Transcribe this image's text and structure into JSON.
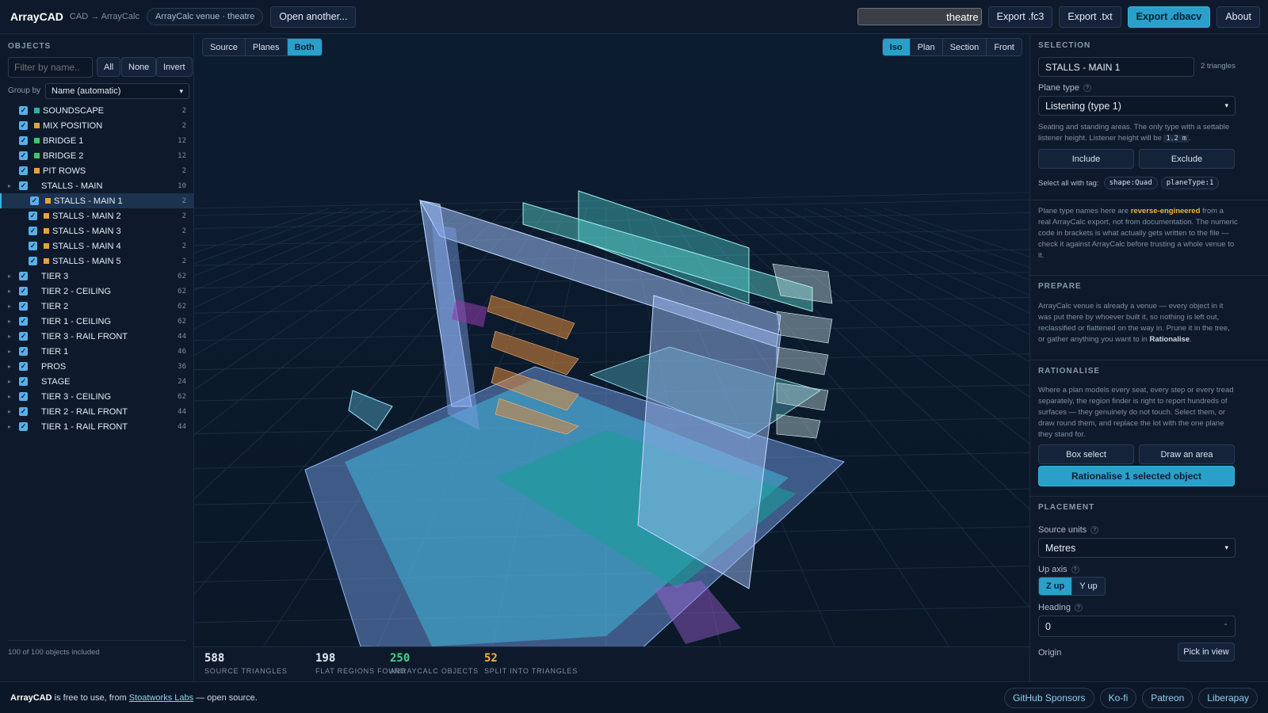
{
  "topbar": {
    "brand": "ArrayCAD",
    "crumb": "CAD → ArrayCalc",
    "venue_pill": "ArrayCalc venue · theatre",
    "open_another": "Open another...",
    "search_value": "theatre",
    "export_fc3": "Export .fc3",
    "export_txt": "Export .txt",
    "export_dbacv": "Export .dbacv",
    "about": "About"
  },
  "objects": {
    "title": "OBJECTS",
    "filter_placeholder": "Filter by name..",
    "all": "All",
    "none": "None",
    "invert": "Invert",
    "group_by_label": "Group by",
    "group_by_value": "Name (automatic)",
    "footer": "100 of 100 objects included",
    "items": [
      {
        "name": "SOUNDSCAPE",
        "count": "2",
        "color": "#2bb3a8",
        "indent": 0,
        "caret": false,
        "selected": false
      },
      {
        "name": "MIX POSITION",
        "count": "2",
        "color": "#e8a23a",
        "indent": 0,
        "caret": false,
        "selected": false
      },
      {
        "name": "BRIDGE 1",
        "count": "12",
        "color": "#45c46a",
        "indent": 0,
        "caret": false,
        "selected": false
      },
      {
        "name": "BRIDGE 2",
        "count": "12",
        "color": "#45c46a",
        "indent": 0,
        "caret": false,
        "selected": false
      },
      {
        "name": "PIT ROWS",
        "count": "2",
        "color": "#e8a23a",
        "indent": 0,
        "caret": false,
        "selected": false
      },
      {
        "name": "STALLS - MAIN",
        "count": "10",
        "color": "",
        "indent": 0,
        "caret": true,
        "selected": false
      },
      {
        "name": "STALLS - MAIN 1",
        "count": "2",
        "color": "#e8a23a",
        "indent": 1,
        "caret": false,
        "selected": true
      },
      {
        "name": "STALLS - MAIN 2",
        "count": "2",
        "color": "#e8a23a",
        "indent": 1,
        "caret": false,
        "selected": false
      },
      {
        "name": "STALLS - MAIN 3",
        "count": "2",
        "color": "#e8a23a",
        "indent": 1,
        "caret": false,
        "selected": false
      },
      {
        "name": "STALLS - MAIN 4",
        "count": "2",
        "color": "#e8a23a",
        "indent": 1,
        "caret": false,
        "selected": false
      },
      {
        "name": "STALLS - MAIN 5",
        "count": "2",
        "color": "#e8a23a",
        "indent": 1,
        "caret": false,
        "selected": false
      },
      {
        "name": "TIER 3",
        "count": "62",
        "color": "",
        "indent": 0,
        "caret": true,
        "selected": false
      },
      {
        "name": "TIER 2 - CEILING",
        "count": "62",
        "color": "",
        "indent": 0,
        "caret": true,
        "selected": false
      },
      {
        "name": "TIER 2",
        "count": "62",
        "color": "",
        "indent": 0,
        "caret": true,
        "selected": false
      },
      {
        "name": "TIER 1 - CEILING",
        "count": "62",
        "color": "",
        "indent": 0,
        "caret": true,
        "selected": false
      },
      {
        "name": "TIER 3 - RAIL FRONT",
        "count": "44",
        "color": "",
        "indent": 0,
        "caret": true,
        "selected": false
      },
      {
        "name": "TIER 1",
        "count": "46",
        "color": "",
        "indent": 0,
        "caret": true,
        "selected": false
      },
      {
        "name": "PROS",
        "count": "36",
        "color": "",
        "indent": 0,
        "caret": true,
        "selected": false
      },
      {
        "name": "STAGE",
        "count": "24",
        "color": "",
        "indent": 0,
        "caret": true,
        "selected": false
      },
      {
        "name": "TIER 3 - CEILING",
        "count": "62",
        "color": "",
        "indent": 0,
        "caret": true,
        "selected": false
      },
      {
        "name": "TIER 2 - RAIL FRONT",
        "count": "44",
        "color": "",
        "indent": 0,
        "caret": true,
        "selected": false
      },
      {
        "name": "TIER 1 - RAIL FRONT",
        "count": "44",
        "color": "",
        "indent": 0,
        "caret": true,
        "selected": false
      }
    ]
  },
  "viewport": {
    "layers": [
      "Source",
      "Planes",
      "Both"
    ],
    "layers_active": "Both",
    "views": [
      "Iso",
      "Plan",
      "Section",
      "Front"
    ],
    "views_active": "Iso"
  },
  "stats": [
    {
      "value": "588",
      "label": "SOURCE TRIANGLES",
      "color": "#e3ebf5"
    },
    {
      "value": "198",
      "label": "FLAT REGIONS FOUND",
      "color": "#e3ebf5"
    },
    {
      "value": "250",
      "label": "ARRAYCALC OBJECTS",
      "color": "#4fd18b"
    },
    {
      "value": "52",
      "label": "SPLIT INTO TRIANGLES",
      "color": "#f0b43a"
    }
  ],
  "selection": {
    "title": "SELECTION",
    "name_value": "STALLS - MAIN 1",
    "triangles": "2 triangles",
    "plane_type_label": "Plane type",
    "plane_type_value": "Listening (type 1)",
    "plane_desc_a": "Seating and standing areas. The only type with a settable listener height. Listener height will be",
    "plane_desc_code": "1.2 m",
    "plane_desc_b": ".",
    "include": "Include",
    "exclude": "Exclude",
    "select_tag_label": "Select all with tag:",
    "tag1": "shape:Quad",
    "tag2": "planeType:1",
    "note_a": "Plane type names here are",
    "note_em": "reverse-engineered",
    "note_b": "from a real ArrayCalc export, not from documentation. The numeric code in brackets is what actually gets written to the file — check it against ArrayCalc before trusting a whole venue to it."
  },
  "prepare": {
    "title": "PREPARE",
    "text_a": "ArrayCalc venue is already a venue — every object in it was put there by whoever built it, so nothing is left out, reclassified or flattened on the way in. Prune it in the tree, or gather anything you want to in",
    "text_em": "Rationalise",
    "text_b": "."
  },
  "rationalise": {
    "title": "RATIONALISE",
    "text": "Where a plan models every seat, every step or every tread separately, the region finder is right to report hundreds of surfaces — they genuinely do not touch. Select them, or draw round them, and replace the lot with the one plane they stand for.",
    "box_select": "Box select",
    "draw_area": "Draw an area",
    "rationalise_btn": "Rationalise 1 selected object"
  },
  "placement": {
    "title": "PLACEMENT",
    "source_units_label": "Source units",
    "source_units_value": "Metres",
    "up_axis_label": "Up axis",
    "z_up": "Z up",
    "y_up": "Y up",
    "heading_label": "Heading",
    "heading_value": "0",
    "origin_label": "Origin",
    "pick_in_view": "Pick in view"
  },
  "footer": {
    "brand": "ArrayCAD",
    "text_a": "is free to use, from",
    "link": "Stoatworks Labs",
    "text_b": "— open source.",
    "buttons": [
      "GitHub Sponsors",
      "Ko-fi",
      "Patreon",
      "Liberapay"
    ]
  }
}
